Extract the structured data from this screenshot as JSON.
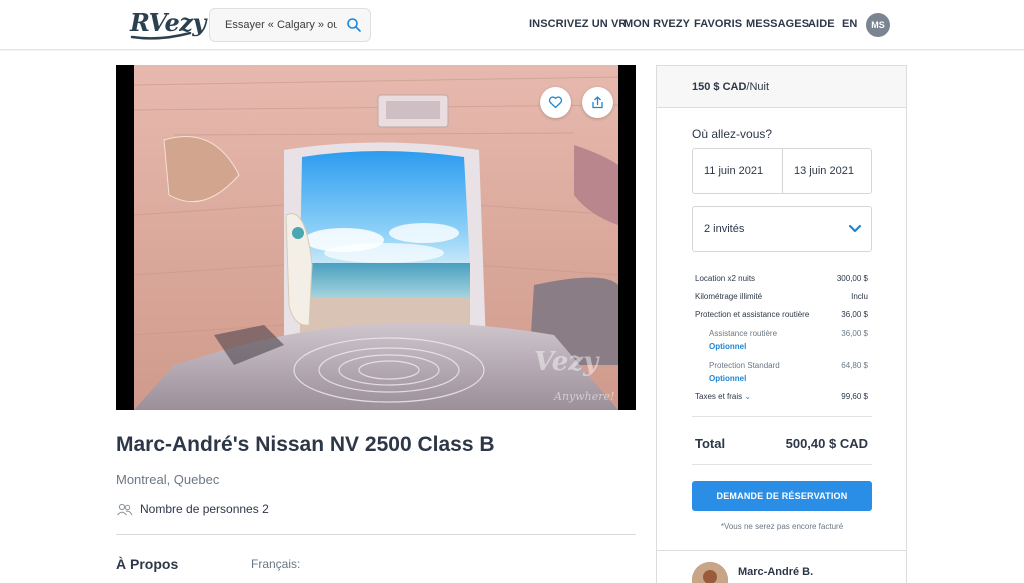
{
  "header": {
    "logo": "RVezy",
    "search_placeholder": "Essayer « Calgary » ou «",
    "nav": [
      "INSCRIVEZ UN VR",
      "MON RVEZY",
      "FAVORIS",
      "MESSAGES",
      "AIDE",
      "EN"
    ],
    "avatar_initials": "MS"
  },
  "listing": {
    "title": "Marc-André's Nissan NV 2500 Class B",
    "location": "Montreal, Quebec",
    "persons_label": "Nombre de personnes 2",
    "about_heading": "À Propos",
    "language": "Français:",
    "watermark": "Vezy",
    "watermark_sub": "Anywhere!"
  },
  "booking": {
    "price_amount": "150 $ CAD",
    "price_unit": "/Nuit",
    "where_label": "Où allez-vous?",
    "start_date": "11 juin 2021",
    "end_date": "13 juin 2021",
    "guests": "2 invités",
    "lines": [
      {
        "label": "Location x2 nuits",
        "value": "300,00 $"
      },
      {
        "label": "Kilométrage illimité",
        "value": "Inclu"
      },
      {
        "label": "Protection et assistance routière",
        "value": "36,00 $"
      }
    ],
    "sub_lines": [
      {
        "label": "Assistance routière",
        "value": "36,00 $",
        "option": "Optionnel"
      },
      {
        "label": "Protection Standard",
        "value": "64,80 $",
        "option": "Optionnel"
      }
    ],
    "taxes_label": "Taxes et frais",
    "taxes_value": "99,60 $",
    "total_label": "Total",
    "total_value": "500,40 $ CAD",
    "button": "DEMANDE DE RÉSERVATION",
    "note": "*Vous ne serez pas encore facturé"
  },
  "host": {
    "name": "Marc-André B."
  },
  "colors": {
    "accent": "#2b8ee6",
    "link": "#1f86d6",
    "text": "#2d3748"
  }
}
